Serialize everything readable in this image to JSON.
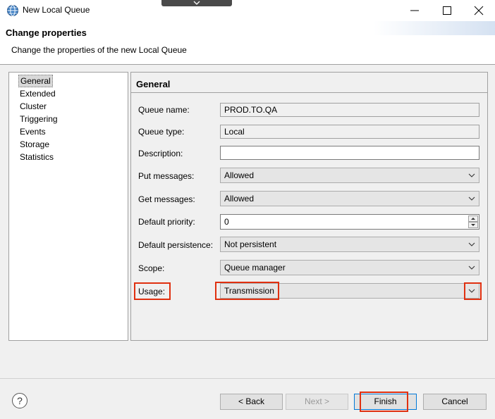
{
  "window": {
    "title": "New Local Queue",
    "icons": {
      "app": "globe-queue-icon",
      "minimize": "minimize-icon",
      "maximize": "maximize-icon",
      "close": "close-icon"
    }
  },
  "header": {
    "title": "Change properties",
    "description": "Change the properties of the new Local Queue"
  },
  "nav": {
    "items": [
      "General",
      "Extended",
      "Cluster",
      "Triggering",
      "Events",
      "Storage",
      "Statistics"
    ],
    "selected": "General"
  },
  "panel": {
    "title": "General",
    "fields": {
      "queue_name": {
        "label": "Queue name:",
        "value": "PROD.TO.QA"
      },
      "queue_type": {
        "label": "Queue type:",
        "value": "Local"
      },
      "description": {
        "label": "Description:",
        "value": ""
      },
      "put_messages": {
        "label": "Put messages:",
        "value": "Allowed"
      },
      "get_messages": {
        "label": "Get messages:",
        "value": "Allowed"
      },
      "default_priority": {
        "label": "Default priority:",
        "value": "0"
      },
      "default_persistence": {
        "label": "Default persistence:",
        "value": "Not persistent"
      },
      "scope": {
        "label": "Scope:",
        "value": "Queue manager"
      },
      "usage": {
        "label": "Usage:",
        "value": "Transmission"
      }
    }
  },
  "buttons": {
    "help": "?",
    "back": "< Back",
    "next": "Next >",
    "finish": "Finish",
    "cancel": "Cancel"
  },
  "colors": {
    "highlight": "#e03010",
    "default_button_border": "#0078d7"
  }
}
